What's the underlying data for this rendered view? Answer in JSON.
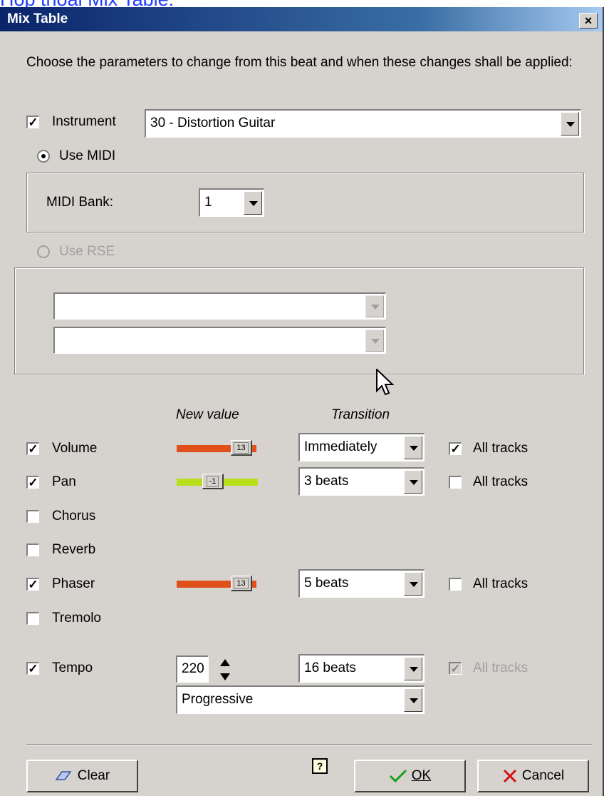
{
  "caption": "Hộp thoại Mix Table.",
  "window": {
    "title": "Mix Table",
    "close_label": "×"
  },
  "intro": "Choose the parameters to change from this beat and when these changes shall be applied:",
  "instrument": {
    "label": "Instrument",
    "checked": "✓",
    "value": "30 - Distortion Guitar"
  },
  "midi": {
    "radio_label": "Use MIDI",
    "bank_label": "MIDI Bank:",
    "bank_value": "1"
  },
  "rse": {
    "radio_label": "Use RSE",
    "combo1_value": "",
    "combo2_value": ""
  },
  "headers": {
    "new_value": "New value",
    "transition": "Transition"
  },
  "rows": {
    "volume": {
      "label": "Volume",
      "checked": "✓",
      "slider_value": "13",
      "slider_level": 0.93,
      "transition": "Immediately",
      "all_tracks_label": "All tracks",
      "all_tracks_checked": "✓"
    },
    "pan": {
      "label": "Pan",
      "checked": "✓",
      "slider_value": "-1",
      "slider_level": 0.43,
      "transition": "3 beats",
      "all_tracks_label": "All tracks",
      "all_tracks_checked": ""
    },
    "chorus": {
      "label": "Chorus",
      "checked": ""
    },
    "reverb": {
      "label": "Reverb",
      "checked": ""
    },
    "phaser": {
      "label": "Phaser",
      "checked": "✓",
      "slider_value": "13",
      "slider_level": 0.93,
      "transition": "5 beats",
      "all_tracks_label": "All tracks",
      "all_tracks_checked": ""
    },
    "tremolo": {
      "label": "Tremolo",
      "checked": ""
    },
    "tempo": {
      "label": "Tempo",
      "checked": "✓",
      "value": "220",
      "transition": "16 beats",
      "mode": "Progressive",
      "all_tracks_label": "All tracks",
      "all_tracks_checked": "✓"
    }
  },
  "buttons": {
    "clear": "Clear",
    "ok": "OK",
    "cancel": "Cancel",
    "help": "?"
  },
  "colors": {
    "orange_track": "#e0501a",
    "green_track": "#b8e01a",
    "title_bar": "#0a246a"
  }
}
